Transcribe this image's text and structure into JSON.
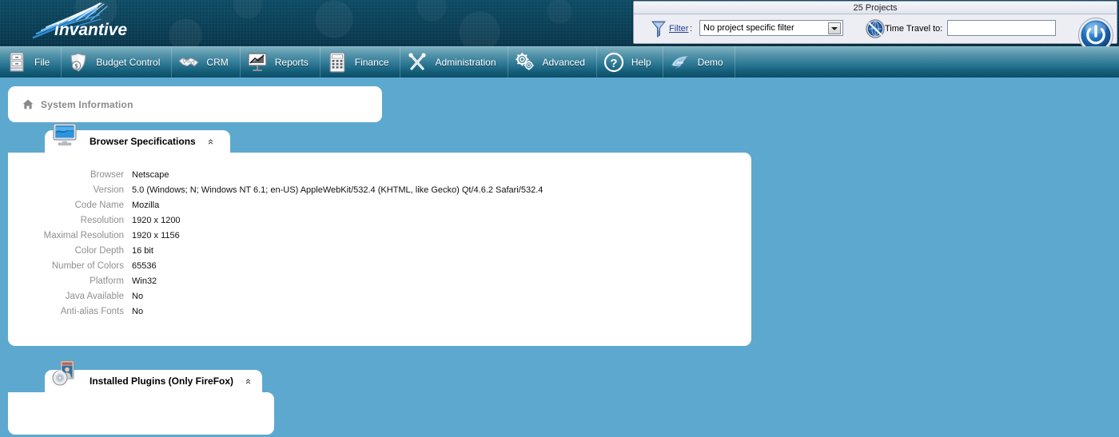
{
  "header": {
    "logo_text": "invantive",
    "filter_panel": {
      "title": "25 Projects",
      "funnel_icon": "funnel-icon",
      "filter_link_label": "Filter",
      "colon": ":",
      "filter_selected_option": "No project specific filter",
      "filter_options": [
        "No project specific filter"
      ],
      "clock_icon": "world-clock-icon",
      "time_travel_label": "Time Travel to:",
      "time_travel_value": "",
      "time_travel_placeholder": "",
      "power_icon": "power-button-icon"
    }
  },
  "menu": {
    "items": [
      {
        "label": "File",
        "icon": "filing-cabinet-icon"
      },
      {
        "label": "Budget Control",
        "icon": "money-shield-icon"
      },
      {
        "label": "CRM",
        "icon": "handshake-icon"
      },
      {
        "label": "Reports",
        "icon": "presentation-chart-icon"
      },
      {
        "label": "Finance",
        "icon": "calculator-icon"
      },
      {
        "label": "Administration",
        "icon": "tools-wrench-screwdriver-icon"
      },
      {
        "label": "Advanced",
        "icon": "gears-icon"
      },
      {
        "label": "Help",
        "icon": "question-mark-circle-icon"
      },
      {
        "label": "Demo",
        "icon": "dolphin-icon"
      }
    ]
  },
  "breadcrumb": {
    "home_icon": "home-icon",
    "label": "System Information"
  },
  "panels": [
    {
      "id": "browser-specifications",
      "title": "Browser Specifications",
      "icon": "monitor-icon",
      "collapse_glyph": "»",
      "rows": [
        {
          "label": "Browser",
          "value": "Netscape"
        },
        {
          "label": "Version",
          "value": "5.0 (Windows; N; Windows NT 6.1; en-US) AppleWebKit/532.4 (KHTML, like Gecko) Qt/4.6.2 Safari/532.4"
        },
        {
          "label": "Code Name",
          "value": "Mozilla"
        },
        {
          "label": "Resolution",
          "value": "1920 x 1200"
        },
        {
          "label": "Maximal Resolution",
          "value": "1920 x 1156"
        },
        {
          "label": "Color Depth",
          "value": "16 bit"
        },
        {
          "label": "Number of Colors",
          "value": "65536"
        },
        {
          "label": "Platform",
          "value": "Win32"
        },
        {
          "label": "Java Available",
          "value": "No"
        },
        {
          "label": "Anti-alias Fonts",
          "value": "No"
        }
      ]
    },
    {
      "id": "installed-plugins",
      "title": "Installed Plugins (Only FireFox)",
      "icon": "plugins-cd-icon",
      "collapse_glyph": "»",
      "rows": []
    }
  ],
  "colors": {
    "page_background": "#5da8cf",
    "header_dark": "#0a3e55",
    "menubar_top": "#7eb0bf",
    "menubar_bottom": "#0c4d66",
    "panel_white": "#ffffff",
    "label_gray": "#8f8f8f",
    "link_blue": "#25408f"
  }
}
